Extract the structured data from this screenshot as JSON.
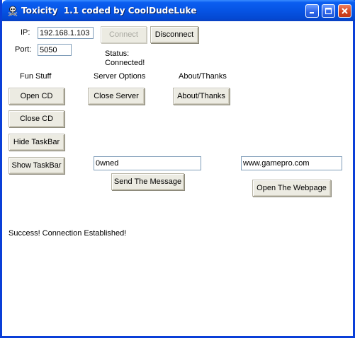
{
  "window": {
    "title": "Toxicity  1.1 coded by CoolDudeLuke"
  },
  "connection": {
    "ip_label": "IP:",
    "ip_value": "192.168.1.103",
    "port_label": "Port:",
    "port_value": "5050",
    "connect_label": "Connect",
    "disconnect_label": "Disconnect",
    "status_label": "Status:",
    "status_value": "Connected!"
  },
  "sections": {
    "fun_stuff": "Fun Stuff",
    "server_options": "Server Options",
    "about_thanks": "About/Thanks"
  },
  "buttons": {
    "open_cd": "Open CD",
    "close_cd": "Close CD",
    "hide_taskbar": "Hide TaskBar",
    "show_taskbar": "Show TaskBar",
    "close_server": "Close Server",
    "about_thanks": "About/Thanks",
    "send_message": "Send The Message",
    "open_webpage": "Open The Webpage"
  },
  "message": {
    "value": "0wned"
  },
  "webpage": {
    "value": "www.gamepro.com"
  },
  "log": {
    "text": "Success! Connection Established!"
  }
}
